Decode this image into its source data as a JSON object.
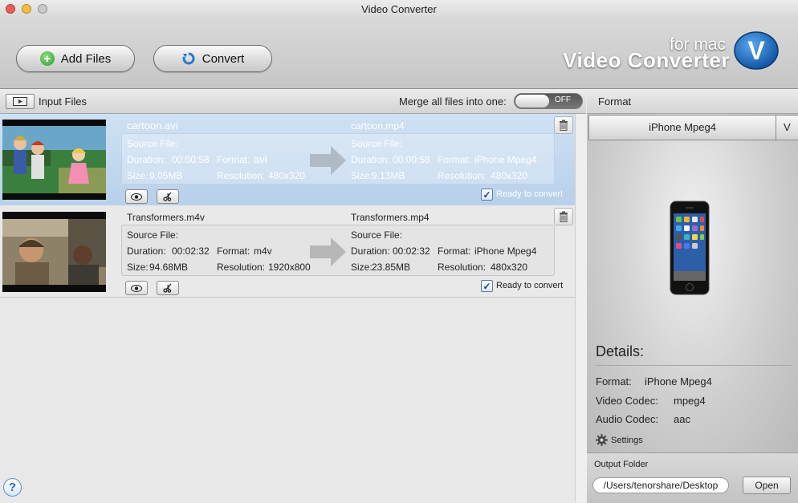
{
  "window": {
    "title": "Video Converter"
  },
  "toolbar": {
    "add_files": "Add Files",
    "convert": "Convert"
  },
  "brand": {
    "small": "for mac",
    "big": "Video Converter",
    "logo_letter": "V"
  },
  "list_header": {
    "input_files": "Input Files",
    "merge_label": "Merge all files into one:",
    "toggle_state": "OFF"
  },
  "format_header": {
    "label": "Format"
  },
  "labels": {
    "source_file": "Source File:",
    "duration": "Duration:",
    "format": "Format:",
    "size": "Size:",
    "resolution": "Resolution:",
    "ready": "Ready to convert"
  },
  "files": [
    {
      "source_name": "cartoon.avi",
      "target_name": "cartoon.mp4",
      "source_duration": "00:00:58",
      "source_format": "avi",
      "source_size": "9.05MB",
      "source_resolution": "480x320",
      "target_duration": "00:00:58",
      "target_format": "iPhone Mpeg4",
      "target_size": "9.13MB",
      "target_resolution": "480x320"
    },
    {
      "source_name": "Transformers.m4v",
      "target_name": "Transformers.mp4",
      "source_duration": "00:02:32",
      "source_format": "m4v",
      "source_size": "94.68MB",
      "source_resolution": "1920x800",
      "target_duration": "00:02:32",
      "target_format": "iPhone Mpeg4",
      "target_size": "23.85MB",
      "target_resolution": "480x320"
    }
  ],
  "format_panel": {
    "selected": "iPhone Mpeg4",
    "dropdown_arrow": "V",
    "details_title": "Details:",
    "format_label": "Format:",
    "format_value": "iPhone Mpeg4",
    "video_codec_label": "Video Codec:",
    "video_codec_value": "mpeg4",
    "audio_codec_label": "Audio Codec:",
    "audio_codec_value": "aac",
    "settings": "Settings"
  },
  "output": {
    "label": "Output Folder",
    "path": "/Users/tenorshare/Desktop",
    "open": "Open"
  },
  "help": "?",
  "colors": {
    "accent_blue": "#1f6fc5",
    "add_green": "#3aa63a",
    "selection": "#c6dbf1"
  }
}
